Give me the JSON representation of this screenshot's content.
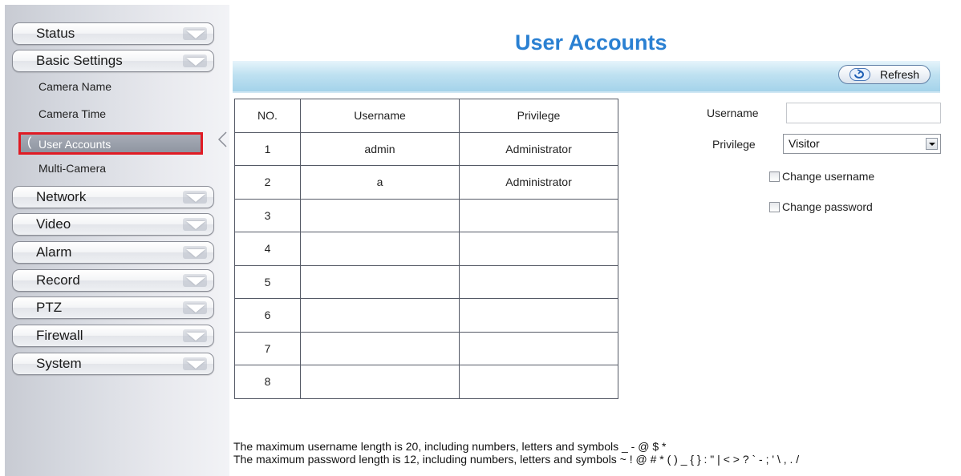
{
  "sidebar": {
    "menus_top": [
      {
        "label": "Status"
      },
      {
        "label": "Basic Settings"
      }
    ],
    "sub_items": [
      {
        "label": "Camera Name"
      },
      {
        "label": "Camera Time"
      },
      {
        "label": "User Accounts",
        "active": true
      },
      {
        "label": "Multi-Camera"
      }
    ],
    "menus_bottom": [
      {
        "label": "Network"
      },
      {
        "label": "Video"
      },
      {
        "label": "Alarm"
      },
      {
        "label": "Record"
      },
      {
        "label": "PTZ"
      },
      {
        "label": "Firewall"
      },
      {
        "label": "System"
      }
    ]
  },
  "main": {
    "title": "User Accounts",
    "refresh_label": "Refresh",
    "table": {
      "headers": [
        "NO.",
        "Username",
        "Privilege"
      ],
      "rows": [
        [
          "1",
          "admin",
          "Administrator"
        ],
        [
          "2",
          "a",
          "Administrator"
        ],
        [
          "3",
          "",
          ""
        ],
        [
          "4",
          "",
          ""
        ],
        [
          "5",
          "",
          ""
        ],
        [
          "6",
          "",
          ""
        ],
        [
          "7",
          "",
          ""
        ],
        [
          "8",
          "",
          ""
        ]
      ]
    },
    "form": {
      "username_label": "Username",
      "username_value": "",
      "privilege_label": "Privilege",
      "privilege_value": "Visitor",
      "change_username": "Change username",
      "change_password": "Change password"
    },
    "notes": [
      "The maximum username length is 20, including numbers, letters and symbols _ - @ $ *",
      "The maximum password length is 12, including numbers, letters and symbols ~ ! @ # * ( ) _ { } : \" | < > ? ` - ; ' \\ , . /"
    ]
  },
  "colors": {
    "title": "#2a80d2",
    "active_border": "#e01b24",
    "toolbar": "#bfe1f1"
  }
}
